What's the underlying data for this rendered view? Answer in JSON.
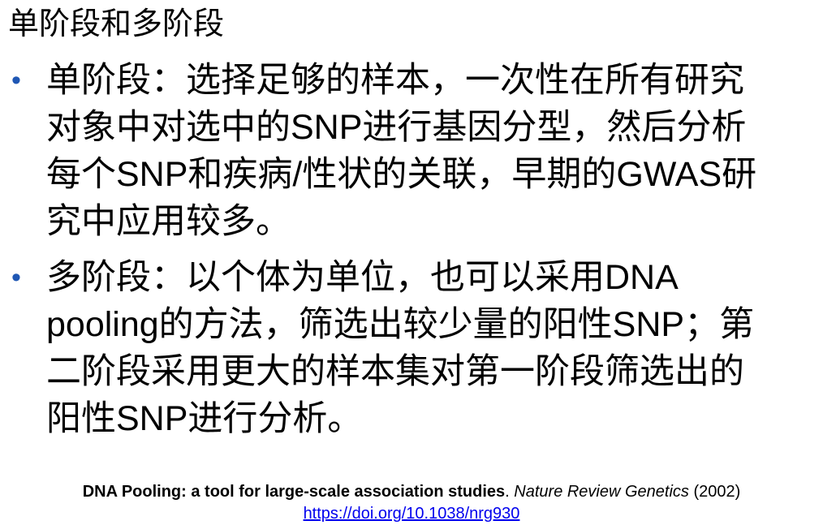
{
  "title": "单阶段和多阶段",
  "bullets": [
    {
      "lines": [
        "单阶段：选择足够的样本，一次性在所有研究",
        "对象中对选中的SNP进行基因分型，然后分析",
        "每个SNP和疾病/性状的关联，早期的GWAS研",
        "究中应用较多。"
      ]
    },
    {
      "lines": [
        "多阶段：以个体为单位，也可以采用DNA",
        "pooling的方法，筛选出较少量的阳性SNP；第",
        "二阶段采用更大的样本集对第一阶段筛选出的",
        "阳性SNP进行分析。"
      ]
    }
  ],
  "citation": {
    "paper_title": "DNA Pooling: a tool for large-scale association studies",
    "separator": ". ",
    "journal": "Nature Review Genetics",
    "year": " (2002)",
    "doi": "https://doi.org/10.1038/nrg930"
  },
  "colors": {
    "bullet": "#1f57b4",
    "link": "#0000ee"
  }
}
